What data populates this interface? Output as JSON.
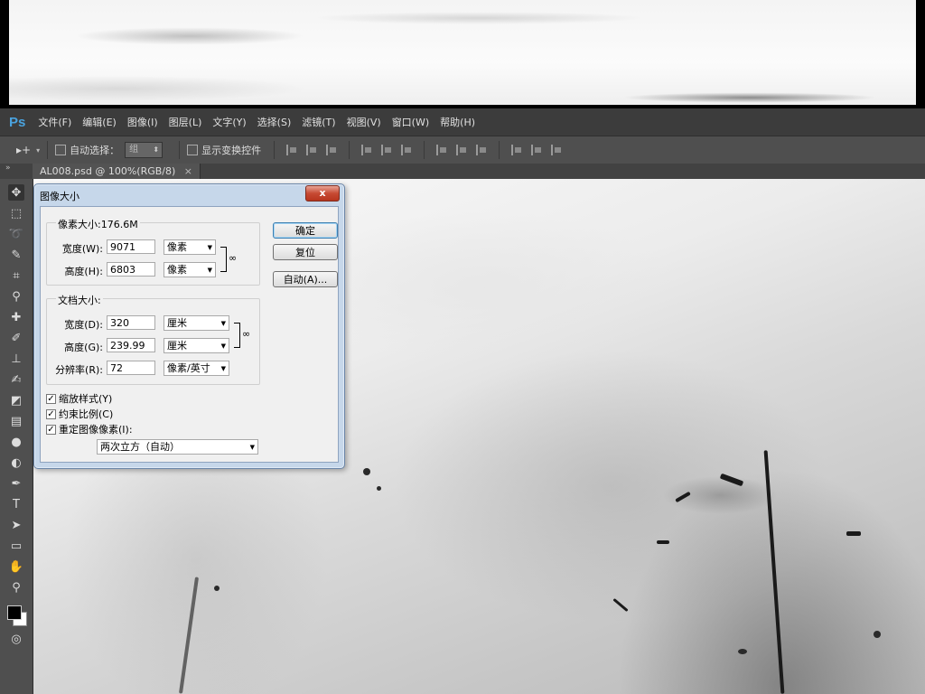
{
  "app": {
    "logo": "Ps"
  },
  "menu": [
    {
      "label": "文件(F)"
    },
    {
      "label": "编辑(E)"
    },
    {
      "label": "图像(I)"
    },
    {
      "label": "图层(L)"
    },
    {
      "label": "文字(Y)"
    },
    {
      "label": "选择(S)"
    },
    {
      "label": "滤镜(T)"
    },
    {
      "label": "视图(V)"
    },
    {
      "label": "窗口(W)"
    },
    {
      "label": "帮助(H)"
    }
  ],
  "options": {
    "tool_glyph": "▸+",
    "auto_select_label": "自动选择：",
    "auto_select_value": "组",
    "show_transform_label": "显示变换控件"
  },
  "document_tab": {
    "label": "AL008.psd @ 100%(RGB/8)",
    "close": "×"
  },
  "dialog": {
    "title": "图像大小",
    "close": "x",
    "pixel_dimensions": {
      "title": "像素大小:176.6M",
      "width_label": "宽度(W):",
      "width_value": "9071",
      "width_unit": "像素",
      "height_label": "高度(H):",
      "height_value": "6803",
      "height_unit": "像素"
    },
    "document_size": {
      "title": "文档大小:",
      "width_label": "宽度(D):",
      "width_value": "320",
      "width_unit": "厘米",
      "height_label": "高度(G):",
      "height_value": "239.99",
      "height_unit": "厘米",
      "resolution_label": "分辨率(R):",
      "resolution_value": "72",
      "resolution_unit": "像素/英寸"
    },
    "options": {
      "scale_styles": "缩放样式(Y)",
      "constrain_proportions": "约束比例(C)",
      "resample": "重定图像像素(I):",
      "resample_method": "两次立方（自动）",
      "scale_styles_checked": true,
      "constrain_checked": true,
      "resample_checked": true
    },
    "buttons": {
      "ok": "确定",
      "reset": "复位",
      "auto": "自动(A)..."
    }
  },
  "colors": {
    "menubar": "#3c3c3c",
    "panel": "#535353",
    "logo": "#4aa3df",
    "foreground_swatch": "#000000",
    "background_swatch": "#ffffff"
  }
}
